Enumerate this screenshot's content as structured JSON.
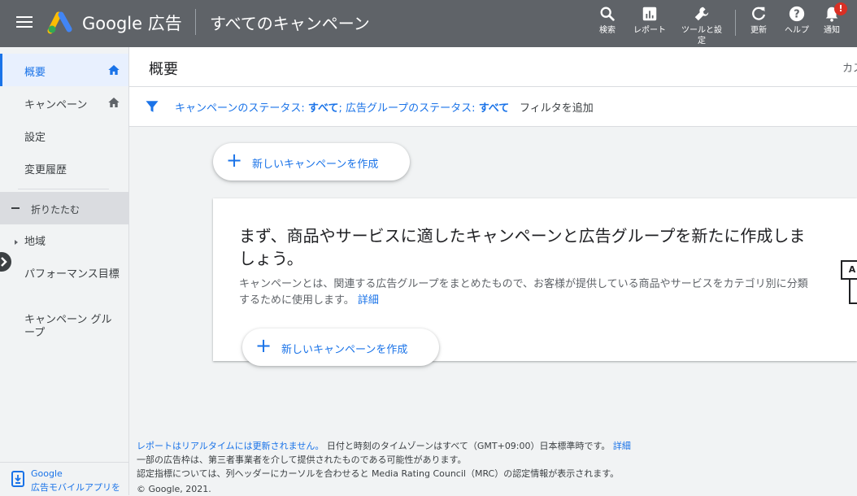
{
  "topbar": {
    "product": "Google 広告",
    "page_title": "すべてのキャンペーン",
    "buttons": [
      {
        "label": "検索",
        "icon": "search-icon"
      },
      {
        "label": "レポート",
        "icon": "report-icon"
      },
      {
        "label": "ツールと設定",
        "icon": "wrench-icon"
      },
      {
        "label": "更新",
        "icon": "refresh-icon"
      },
      {
        "label": "ヘルプ",
        "icon": "help-icon"
      },
      {
        "label": "通知",
        "icon": "bell-icon"
      }
    ],
    "notification_badge": "!"
  },
  "sidebar": {
    "items": [
      {
        "label": "概要"
      },
      {
        "label": "キャンペーン"
      },
      {
        "label": "設定"
      },
      {
        "label": "変更履歴"
      }
    ],
    "collapse_label": "折りたたむ",
    "sub_items": [
      {
        "label": "地域"
      },
      {
        "label": "パフォーマンス目標"
      },
      {
        "label": "キャンペーン グループ"
      }
    ],
    "app_promo_line1": "Google",
    "app_promo_line2": "広告モバイルアプリを"
  },
  "main": {
    "title": "概要",
    "header_right": "カス",
    "filter": {
      "status_label": "キャンペーンのステータス:",
      "status_value": "すべて",
      "group_label": "; 広告グループのステータス:",
      "group_value": "すべて",
      "add_filter": "フィルタを追加"
    },
    "new_campaign_button": "新しいキャンペーンを作成",
    "card": {
      "heading": "まず、商品やサービスに適したキャンペーンと広告グループを新たに作成しましょう。",
      "body": "キャンペーンとは、関連する広告グループをまとめたもので、お客様が提供している商品やサービスをカテゴリ別に分類するために使用します。",
      "link": "詳細",
      "illustration_letter": "A"
    },
    "card_button": "新しいキャンペーンを作成"
  },
  "footer": {
    "line1_link": "レポートはリアルタイムには更新されません。",
    "line1_text": "日付と時刻のタイムゾーンはすべて（GMT+09:00）日本標準時です。",
    "line1_more": "詳細",
    "line2": "一部の広告枠は、第三者事業者を介して提供されたものである可能性があります。",
    "line3": "認定指標については、列ヘッダーにカーソルを合わせると Media Rating Council（MRC）の認定情報が表示されます。",
    "copyright": "© Google, 2021."
  },
  "colors": {
    "topbar": "#5f6368",
    "accent": "#1a73e8",
    "badge": "#d93025"
  }
}
